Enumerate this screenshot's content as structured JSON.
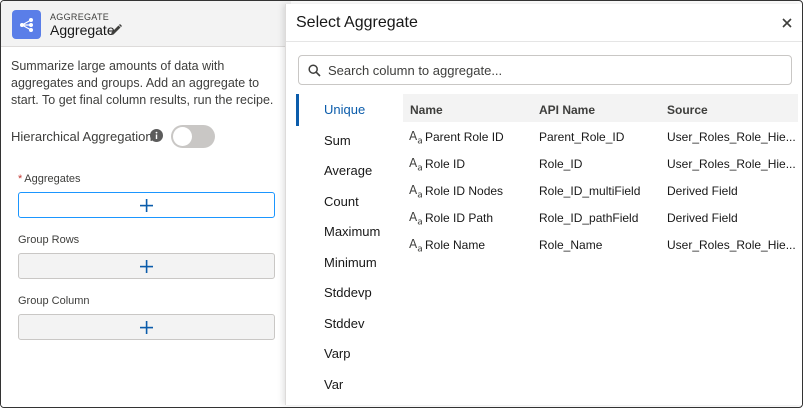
{
  "node": {
    "type_label": "AGGREGATE",
    "name": "Aggregate",
    "description": "Summarize large amounts of data with aggregates and groups. Add an aggregate to start. To get final column results, run the recipe."
  },
  "hierarchical": {
    "label": "Hierarchical Aggregation",
    "enabled": false
  },
  "fields": {
    "aggregates_required": "*",
    "aggregates_label": "Aggregates",
    "group_rows_label": "Group Rows",
    "group_column_label": "Group Column",
    "add_glyph": "+"
  },
  "popover": {
    "title": "Select Aggregate",
    "close_glyph": "×",
    "search_placeholder": "Search column to aggregate...",
    "functions": [
      "Unique",
      "Sum",
      "Average",
      "Count",
      "Maximum",
      "Minimum",
      "Stddevp",
      "Stddev",
      "Varp",
      "Var"
    ],
    "selected_function": "Unique",
    "columns": {
      "name": "Name",
      "api_name": "API Name",
      "source": "Source"
    },
    "rows": [
      {
        "name": "Parent Role ID",
        "api_name": "Parent_Role_ID",
        "source": "User_Roles_Role_Hie..."
      },
      {
        "name": "Role ID",
        "api_name": "Role_ID",
        "source": "User_Roles_Role_Hie..."
      },
      {
        "name": "Role ID Nodes",
        "api_name": "Role_ID_multiField",
        "source": "Derived Field"
      },
      {
        "name": "Role ID Path",
        "api_name": "Role_ID_pathField",
        "source": "Derived Field"
      },
      {
        "name": "Role Name",
        "api_name": "Role_Name",
        "source": "User_Roles_Role_Hie..."
      }
    ]
  },
  "colors": {
    "accent": "#0b5cab",
    "node_icon": "#5a7ee8",
    "required": "#c23934"
  }
}
